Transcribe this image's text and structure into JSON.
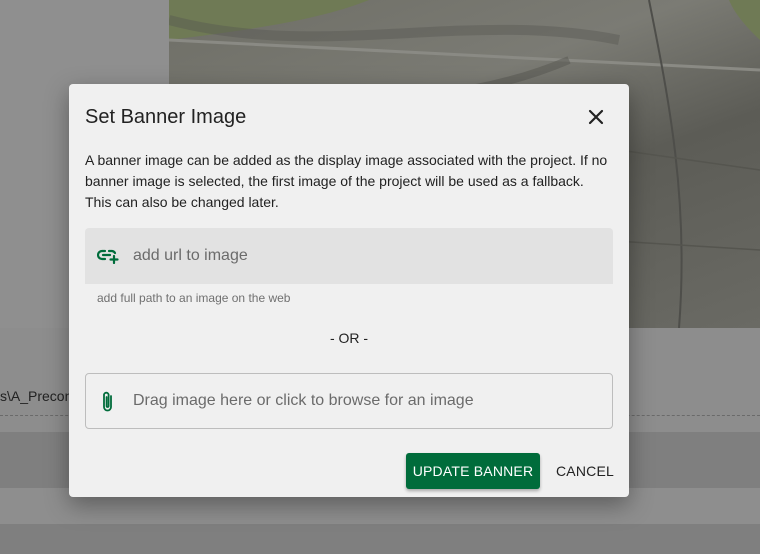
{
  "background": {
    "path_fragment": "s\\A_Precon"
  },
  "dialog": {
    "title": "Set Banner Image",
    "close_icon": "close-icon",
    "description": "A banner image can be added as the display image associated with the project. If no banner image is selected, the first image of the project will be used as a fallback. This can also be changed later.",
    "url_input": {
      "placeholder": "add url to image",
      "value": "",
      "icon": "link-add-icon",
      "hint": "add full path to an image on the web"
    },
    "separator": "- OR -",
    "drop_zone": {
      "label": "Drag image here or click to browse for an image",
      "icon": "paperclip-icon"
    },
    "actions": {
      "update_label": "UPDATE BANNER",
      "cancel_label": "CANCEL"
    }
  },
  "colors": {
    "primary": "#006c3b",
    "dialog_bg": "#f0f0f0",
    "overlay": "#8d8d8d"
  }
}
